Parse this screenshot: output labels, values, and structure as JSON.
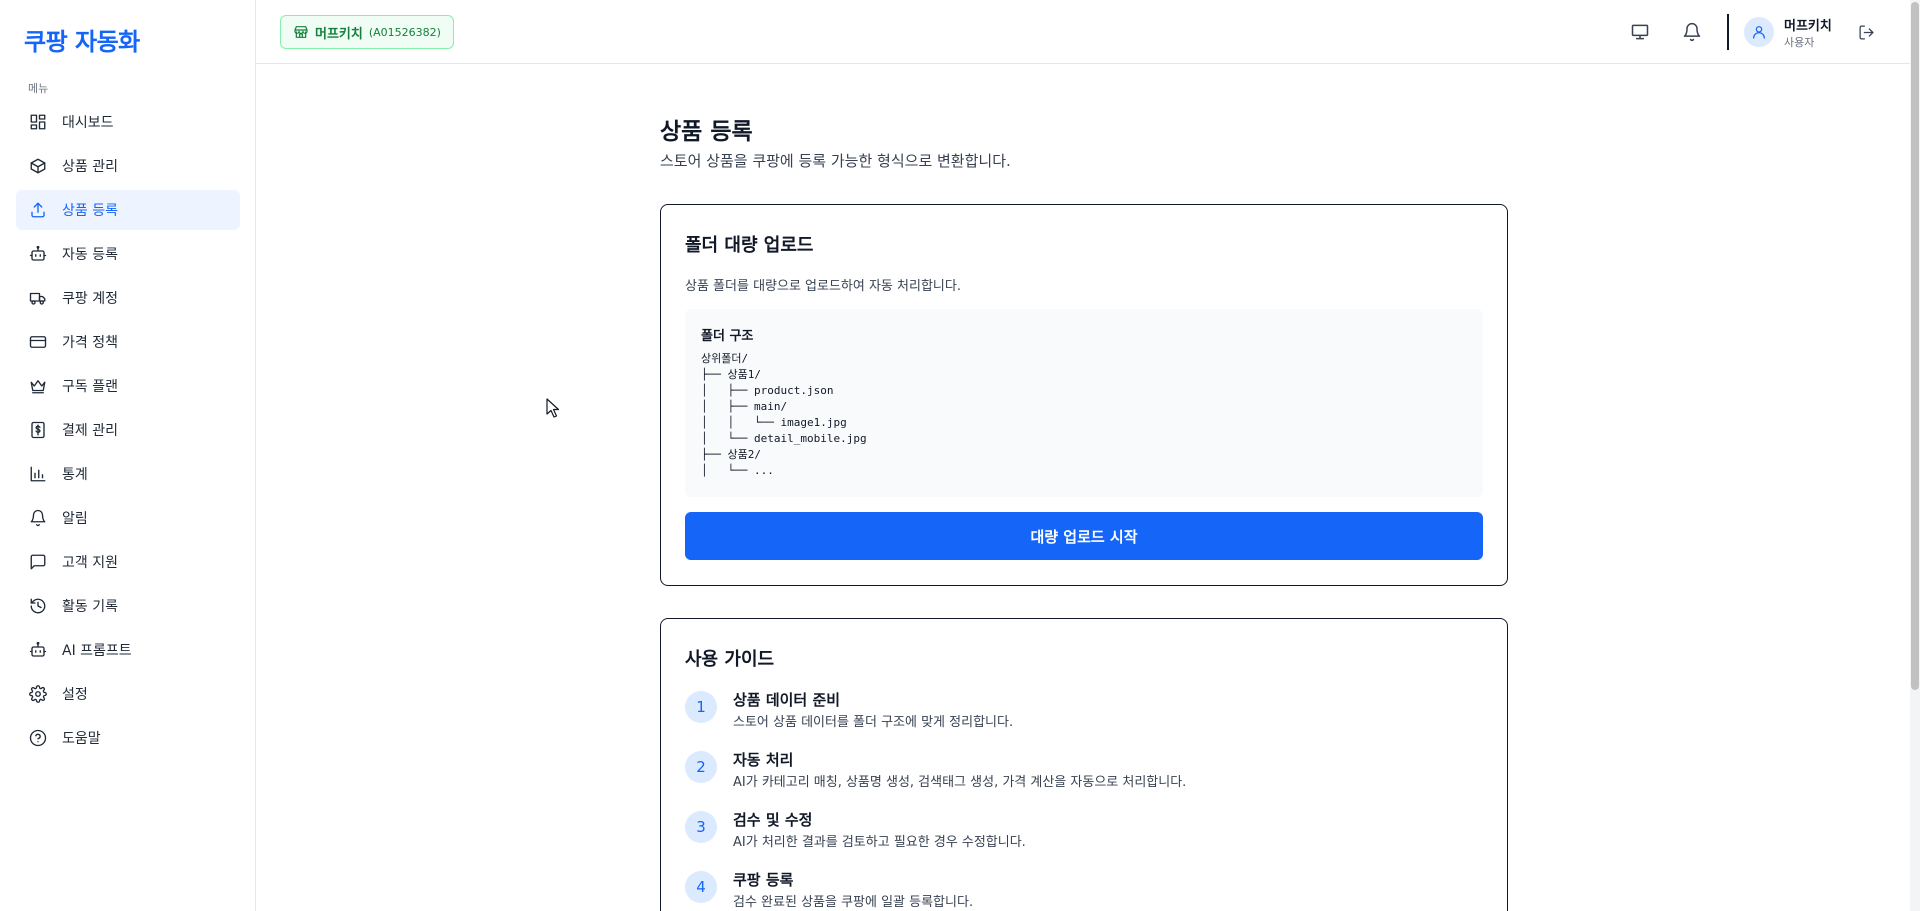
{
  "app": {
    "logo": "쿠팡 자동화"
  },
  "sidebar": {
    "section_label": "메뉴",
    "items": [
      {
        "label": "대시보드",
        "icon": "dashboard-icon"
      },
      {
        "label": "상품 관리",
        "icon": "package-icon"
      },
      {
        "label": "상품 등록",
        "icon": "upload-icon",
        "active": true
      },
      {
        "label": "자동 등록",
        "icon": "bot-icon"
      },
      {
        "label": "쿠팡 계정",
        "icon": "truck-icon"
      },
      {
        "label": "가격 정책",
        "icon": "credit-card-icon"
      },
      {
        "label": "구독 플랜",
        "icon": "crown-icon"
      },
      {
        "label": "결제 관리",
        "icon": "dollar-receipt-icon"
      },
      {
        "label": "통계",
        "icon": "bar-chart-icon"
      },
      {
        "label": "알림",
        "icon": "bell-icon"
      },
      {
        "label": "고객 지원",
        "icon": "message-square-icon"
      },
      {
        "label": "활동 기록",
        "icon": "history-icon"
      },
      {
        "label": "AI 프롬프트",
        "icon": "bot-icon"
      },
      {
        "label": "설정",
        "icon": "gear-icon"
      },
      {
        "label": "도움말",
        "icon": "help-circle-icon"
      }
    ]
  },
  "header": {
    "store_name": "머프키치",
    "store_code": "(A01526382)",
    "user_name": "머프키치",
    "user_role": "사용자"
  },
  "main": {
    "title": "상품 등록",
    "subtitle": "스토어 상품을 쿠팡에 등록 가능한 형식으로 변환합니다.",
    "upload_card": {
      "title": "폴더 대량 업로드",
      "description": "상품 폴더를 대량으로 업로드하여 자동 처리합니다.",
      "structure_title": "폴더 구조",
      "structure_lines": [
        "상위폴더/",
        "├── 상품1/",
        "│   ├── product.json",
        "│   ├── main/",
        "│   │   └── image1.jpg",
        "│   └── detail_mobile.jpg",
        "├── 상품2/",
        "│   └── ..."
      ],
      "button_label": "대량 업로드 시작"
    },
    "guide_card": {
      "title": "사용 가이드",
      "steps": [
        {
          "num": "1",
          "title": "상품 데이터 준비",
          "desc": "스토어 상품 데이터를 폴더 구조에 맞게 정리합니다."
        },
        {
          "num": "2",
          "title": "자동 처리",
          "desc": "AI가 카테고리 매칭, 상품명 생성, 검색태그 생성, 가격 계산을 자동으로 처리합니다."
        },
        {
          "num": "3",
          "title": "검수 및 수정",
          "desc": "AI가 처리한 결과를 검토하고 필요한 경우 수정합니다."
        },
        {
          "num": "4",
          "title": "쿠팡 등록",
          "desc": "검수 완료된 상품을 쿠팡에 일괄 등록합니다."
        }
      ]
    }
  },
  "colors": {
    "accent": "#1565f8",
    "store_badge": "#15803d",
    "active_bg": "#eef4ff"
  }
}
